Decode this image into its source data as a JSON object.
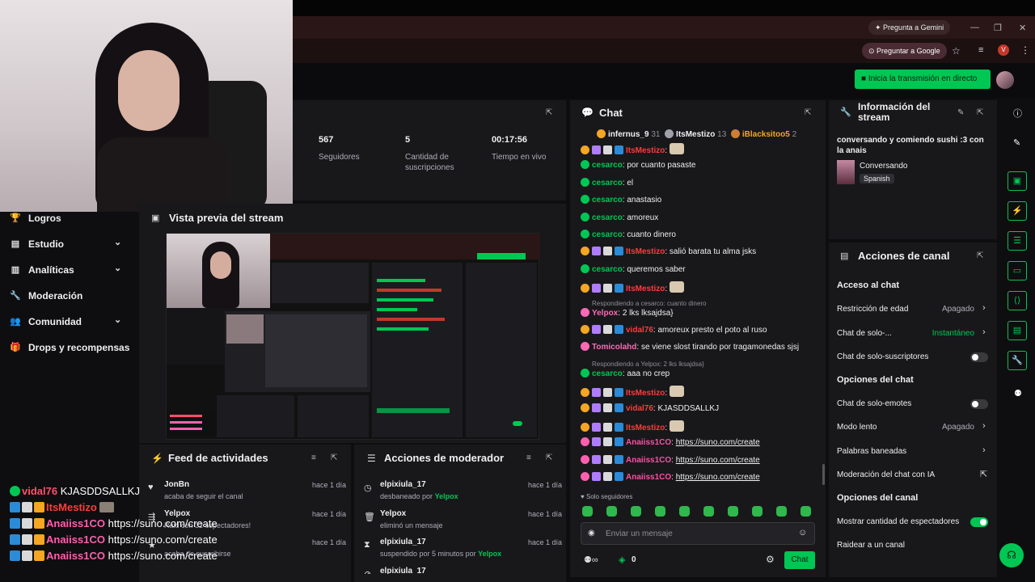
{
  "browser": {
    "gemini_label": "Pregunta a Gemini",
    "google_label": "Preguntar a Google",
    "profile_initial": "V"
  },
  "app": {
    "live_button": "Inicia la transmisión en directo"
  },
  "nav": [
    {
      "icon": "trophy-icon",
      "glyph": "🏆",
      "label": "Logros",
      "has_chevron": false
    },
    {
      "icon": "studio-icon",
      "glyph": "▤",
      "label": "Estudio",
      "has_chevron": true
    },
    {
      "icon": "analytics-icon",
      "glyph": "▥",
      "label": "Analíticas",
      "has_chevron": true
    },
    {
      "icon": "wrench-icon",
      "glyph": "🔧",
      "label": "Moderación",
      "has_chevron": false
    },
    {
      "icon": "community-icon",
      "glyph": "👥",
      "label": "Comunidad",
      "has_chevron": true
    },
    {
      "icon": "gift-icon",
      "glyph": "🎁",
      "label": "Drops y recompensas",
      "has_chevron": false
    }
  ],
  "stats": [
    {
      "value": "567",
      "label": "Seguidores"
    },
    {
      "value": "5",
      "label": "Cantidad de suscripciones"
    },
    {
      "value": "00:17:56",
      "label": "Tiempo en vivo"
    }
  ],
  "preview": {
    "title": "Vista previa del stream"
  },
  "feed": {
    "title": "Feed de actividades",
    "items": [
      {
        "name": "JonBn",
        "sub": "acaba de seguir el canal",
        "time": "hace 1 día"
      },
      {
        "name": "Yelpox",
        "sub": "Raid con 32 espectadores!",
        "time": "hace 1 día"
      },
      {
        "name": "",
        "sub": "acaba de suscribirse",
        "time": "hace 1 día"
      }
    ]
  },
  "mod_actions": {
    "title": "Acciones de moderador",
    "items": [
      {
        "name": "elpixiula_17",
        "sub": "desbaneado por",
        "by": "Yelpox",
        "time": "hace 1 día",
        "icon": "unban-icon"
      },
      {
        "name": "Yelpox",
        "sub": "eliminó un mensaje",
        "by": "",
        "time": "hace 1 día",
        "icon": "trash-icon"
      },
      {
        "name": "elpixiula_17",
        "sub": "suspendido por 5 minutos por",
        "by": "Yelpox",
        "time": "hace 1 día",
        "icon": "hourglass-icon"
      },
      {
        "name": "elpixiula_17",
        "sub": "",
        "by": "",
        "time": "",
        "icon": "ban-icon"
      }
    ]
  },
  "chat": {
    "title": "Chat",
    "leaders": [
      {
        "name": "infernus_9",
        "count": "31"
      },
      {
        "name": "ItsMestizo",
        "count": "13"
      },
      {
        "name": "iBlacksitoo5",
        "count": "2"
      }
    ],
    "messages": [
      {
        "user": "ItsMestizo",
        "color": "u-red",
        "text": "",
        "emote": true
      },
      {
        "user": "cesarco",
        "color": "u-green",
        "text": "por cuanto pasaste"
      },
      {
        "user": "cesarco",
        "color": "u-green",
        "text": "el"
      },
      {
        "user": "cesarco",
        "color": "u-green",
        "text": "anastasio"
      },
      {
        "user": "cesarco",
        "color": "u-green",
        "text": "amoreux"
      },
      {
        "user": "cesarco",
        "color": "u-green",
        "text": "cuanto dinero"
      },
      {
        "user": "ItsMestizo",
        "color": "u-red",
        "text": "salió barata tu alma jsks"
      },
      {
        "user": "cesarco",
        "color": "u-green",
        "text": "queremos saber"
      },
      {
        "user": "ItsMestizo",
        "color": "u-red",
        "text": "",
        "emote": true
      },
      {
        "reply": "Respondiendo a cesarco: cuanto dinero"
      },
      {
        "user": "Yelpox",
        "color": "u-mag",
        "text": "2 lks lksajdsa}"
      },
      {
        "user": "vidal76",
        "color": "u-red",
        "text": "amoreux presto el poto al ruso"
      },
      {
        "user": "Tomicolahd",
        "color": "u-mag",
        "text": "se viene slost tirando por tragamonedas sjsj"
      },
      {
        "reply": "Respondiendo a Yelpox: 2 lks lksajdsa}"
      },
      {
        "user": "cesarco",
        "color": "u-green",
        "text": "aaa no crep"
      },
      {
        "user": "ItsMestizo",
        "color": "u-red",
        "text": "",
        "emote": true
      },
      {
        "user": "vidal76",
        "color": "u-red",
        "text": "KJASDDSALLKJ"
      },
      {
        "user": "ItsMestizo",
        "color": "u-red",
        "text": "",
        "emote": true
      },
      {
        "user": "Anaiiss1CO",
        "color": "u-pink",
        "text": "https://suno.com/create",
        "link": true
      },
      {
        "user": "Anaiiss1CO",
        "color": "u-pink",
        "text": "https://suno.com/create",
        "link": true
      },
      {
        "user": "Anaiiss1CO",
        "color": "u-pink",
        "text": "https://suno.com/create",
        "link": true
      }
    ],
    "followers_only": "Solo seguidores",
    "input_placeholder": "Enviar un mensaje",
    "send_label": "Chat",
    "points": "0"
  },
  "info": {
    "title": "Información del stream",
    "stream_title": "conversando y comiendo sushi :3 con la anais",
    "category": "Conversando",
    "language": "Spanish"
  },
  "channel_actions": {
    "title": "Acciones de canal",
    "sections": [
      {
        "heading": "Acceso al chat"
      },
      {
        "label": "Restricción de edad",
        "value": "Apagado",
        "kind": "chevron"
      },
      {
        "label": "Chat de solo-...",
        "value": "Instantáneo",
        "kind": "chevron",
        "accent": true
      },
      {
        "label": "Chat de solo-suscriptores",
        "kind": "toggle",
        "on": false
      },
      {
        "heading": "Opciones del chat"
      },
      {
        "label": "Chat de solo-emotes",
        "kind": "toggle",
        "on": false
      },
      {
        "label": "Modo lento",
        "value": "Apagado",
        "kind": "chevron"
      },
      {
        "label": "Palabras baneadas",
        "kind": "chevron"
      },
      {
        "label": "Moderación del chat con IA",
        "kind": "external"
      },
      {
        "heading": "Opciones del canal"
      },
      {
        "label": "Mostrar cantidad de espectadores",
        "kind": "toggle",
        "on": true
      },
      {
        "label": "Raidear a un canal",
        "kind": "none"
      }
    ]
  },
  "overlay_chat": [
    {
      "user": "vidal76",
      "color": "#ff4f6b",
      "text": "KJASDDSALLKJ"
    },
    {
      "user": "ItsMestizo",
      "color": "#ff3b3b",
      "text": ""
    },
    {
      "user": "Anaiiss1CO",
      "color": "#ff5fae",
      "text": "https://suno.com/create"
    },
    {
      "user": "Anaiiss1CO",
      "color": "#ff5fae",
      "text": "https://suno.com/create"
    },
    {
      "user": "Anaiiss1CO",
      "color": "#ff5fae",
      "text": "https://suno.com/create"
    }
  ],
  "colors": {
    "accent": "#00c754",
    "panel": "#18181b",
    "bg": "#0e0e10"
  }
}
